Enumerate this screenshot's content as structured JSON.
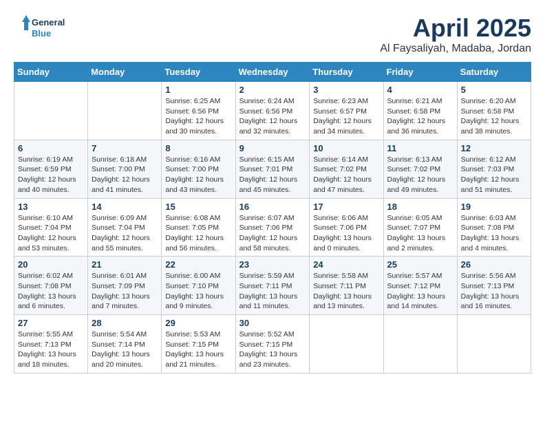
{
  "header": {
    "logo_line1": "General",
    "logo_line2": "Blue",
    "title": "April 2025",
    "subtitle": "Al Faysaliyah, Madaba, Jordan"
  },
  "weekdays": [
    "Sunday",
    "Monday",
    "Tuesday",
    "Wednesday",
    "Thursday",
    "Friday",
    "Saturday"
  ],
  "weeks": [
    [
      {
        "day": "",
        "info": ""
      },
      {
        "day": "",
        "info": ""
      },
      {
        "day": "1",
        "info": "Sunrise: 6:25 AM\nSunset: 6:56 PM\nDaylight: 12 hours and 30 minutes."
      },
      {
        "day": "2",
        "info": "Sunrise: 6:24 AM\nSunset: 6:56 PM\nDaylight: 12 hours and 32 minutes."
      },
      {
        "day": "3",
        "info": "Sunrise: 6:23 AM\nSunset: 6:57 PM\nDaylight: 12 hours and 34 minutes."
      },
      {
        "day": "4",
        "info": "Sunrise: 6:21 AM\nSunset: 6:58 PM\nDaylight: 12 hours and 36 minutes."
      },
      {
        "day": "5",
        "info": "Sunrise: 6:20 AM\nSunset: 6:58 PM\nDaylight: 12 hours and 38 minutes."
      }
    ],
    [
      {
        "day": "6",
        "info": "Sunrise: 6:19 AM\nSunset: 6:59 PM\nDaylight: 12 hours and 40 minutes."
      },
      {
        "day": "7",
        "info": "Sunrise: 6:18 AM\nSunset: 7:00 PM\nDaylight: 12 hours and 41 minutes."
      },
      {
        "day": "8",
        "info": "Sunrise: 6:16 AM\nSunset: 7:00 PM\nDaylight: 12 hours and 43 minutes."
      },
      {
        "day": "9",
        "info": "Sunrise: 6:15 AM\nSunset: 7:01 PM\nDaylight: 12 hours and 45 minutes."
      },
      {
        "day": "10",
        "info": "Sunrise: 6:14 AM\nSunset: 7:02 PM\nDaylight: 12 hours and 47 minutes."
      },
      {
        "day": "11",
        "info": "Sunrise: 6:13 AM\nSunset: 7:02 PM\nDaylight: 12 hours and 49 minutes."
      },
      {
        "day": "12",
        "info": "Sunrise: 6:12 AM\nSunset: 7:03 PM\nDaylight: 12 hours and 51 minutes."
      }
    ],
    [
      {
        "day": "13",
        "info": "Sunrise: 6:10 AM\nSunset: 7:04 PM\nDaylight: 12 hours and 53 minutes."
      },
      {
        "day": "14",
        "info": "Sunrise: 6:09 AM\nSunset: 7:04 PM\nDaylight: 12 hours and 55 minutes."
      },
      {
        "day": "15",
        "info": "Sunrise: 6:08 AM\nSunset: 7:05 PM\nDaylight: 12 hours and 56 minutes."
      },
      {
        "day": "16",
        "info": "Sunrise: 6:07 AM\nSunset: 7:06 PM\nDaylight: 12 hours and 58 minutes."
      },
      {
        "day": "17",
        "info": "Sunrise: 6:06 AM\nSunset: 7:06 PM\nDaylight: 13 hours and 0 minutes."
      },
      {
        "day": "18",
        "info": "Sunrise: 6:05 AM\nSunset: 7:07 PM\nDaylight: 13 hours and 2 minutes."
      },
      {
        "day": "19",
        "info": "Sunrise: 6:03 AM\nSunset: 7:08 PM\nDaylight: 13 hours and 4 minutes."
      }
    ],
    [
      {
        "day": "20",
        "info": "Sunrise: 6:02 AM\nSunset: 7:08 PM\nDaylight: 13 hours and 6 minutes."
      },
      {
        "day": "21",
        "info": "Sunrise: 6:01 AM\nSunset: 7:09 PM\nDaylight: 13 hours and 7 minutes."
      },
      {
        "day": "22",
        "info": "Sunrise: 6:00 AM\nSunset: 7:10 PM\nDaylight: 13 hours and 9 minutes."
      },
      {
        "day": "23",
        "info": "Sunrise: 5:59 AM\nSunset: 7:11 PM\nDaylight: 13 hours and 11 minutes."
      },
      {
        "day": "24",
        "info": "Sunrise: 5:58 AM\nSunset: 7:11 PM\nDaylight: 13 hours and 13 minutes."
      },
      {
        "day": "25",
        "info": "Sunrise: 5:57 AM\nSunset: 7:12 PM\nDaylight: 13 hours and 14 minutes."
      },
      {
        "day": "26",
        "info": "Sunrise: 5:56 AM\nSunset: 7:13 PM\nDaylight: 13 hours and 16 minutes."
      }
    ],
    [
      {
        "day": "27",
        "info": "Sunrise: 5:55 AM\nSunset: 7:13 PM\nDaylight: 13 hours and 18 minutes."
      },
      {
        "day": "28",
        "info": "Sunrise: 5:54 AM\nSunset: 7:14 PM\nDaylight: 13 hours and 20 minutes."
      },
      {
        "day": "29",
        "info": "Sunrise: 5:53 AM\nSunset: 7:15 PM\nDaylight: 13 hours and 21 minutes."
      },
      {
        "day": "30",
        "info": "Sunrise: 5:52 AM\nSunset: 7:15 PM\nDaylight: 13 hours and 23 minutes."
      },
      {
        "day": "",
        "info": ""
      },
      {
        "day": "",
        "info": ""
      },
      {
        "day": "",
        "info": ""
      }
    ]
  ]
}
